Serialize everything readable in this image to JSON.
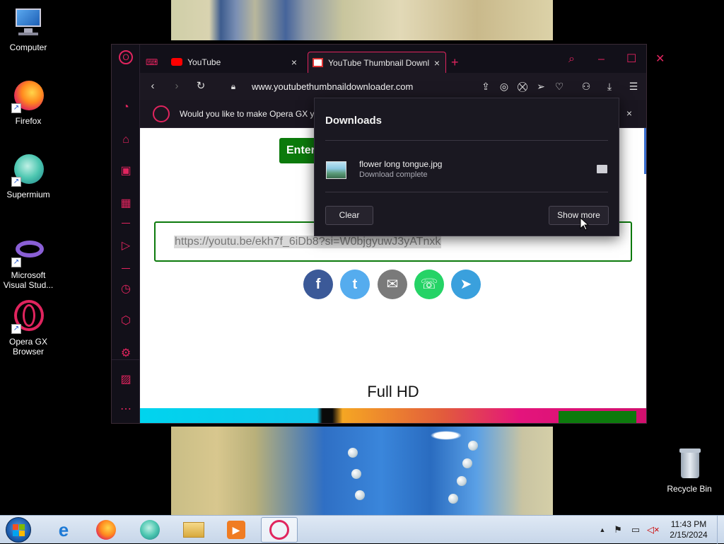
{
  "desktop": {
    "icons": [
      {
        "label": "Computer"
      },
      {
        "label": "Firefox"
      },
      {
        "label": "Supermium"
      },
      {
        "label": "Microsoft Visual Stud..."
      },
      {
        "label": "Opera GX Browser"
      },
      {
        "label": "Recycle Bin"
      }
    ]
  },
  "browser": {
    "tabs": [
      {
        "label": "YouTube",
        "close": "×"
      },
      {
        "label": "YouTube Thumbnail Downl",
        "close": "×"
      }
    ],
    "new_tab": "+",
    "url": "www.youtubethumbnaildownloader.com",
    "notification": {
      "text": "Would you like to make Opera GX y",
      "close": "×"
    },
    "accent_color": "#e0245e"
  },
  "page": {
    "enter_button": "Enter",
    "url_input_value": "https://youtu.be/ekh7f_6iDb8?si=W0bjgyuwJ3yATnxk",
    "share": [
      {
        "icon": "facebook-icon",
        "glyph": "f",
        "color": "#3b5998"
      },
      {
        "icon": "twitter-icon",
        "glyph": "t",
        "color": "#55acee"
      },
      {
        "icon": "email-icon",
        "glyph": "✉",
        "color": "#7a7a7a"
      },
      {
        "icon": "whatsapp-icon",
        "glyph": "☏",
        "color": "#25d366"
      },
      {
        "icon": "telegram-icon",
        "glyph": "➤",
        "color": "#3aa0dd"
      }
    ],
    "quality_heading": "Full HD"
  },
  "downloads": {
    "title": "Downloads",
    "item": {
      "filename": "flower long tongue.jpg",
      "status": "Download complete"
    },
    "clear_label": "Clear",
    "show_more_label": "Show more"
  },
  "taskbar": {
    "time": "11:43 PM",
    "date": "2/15/2024"
  }
}
